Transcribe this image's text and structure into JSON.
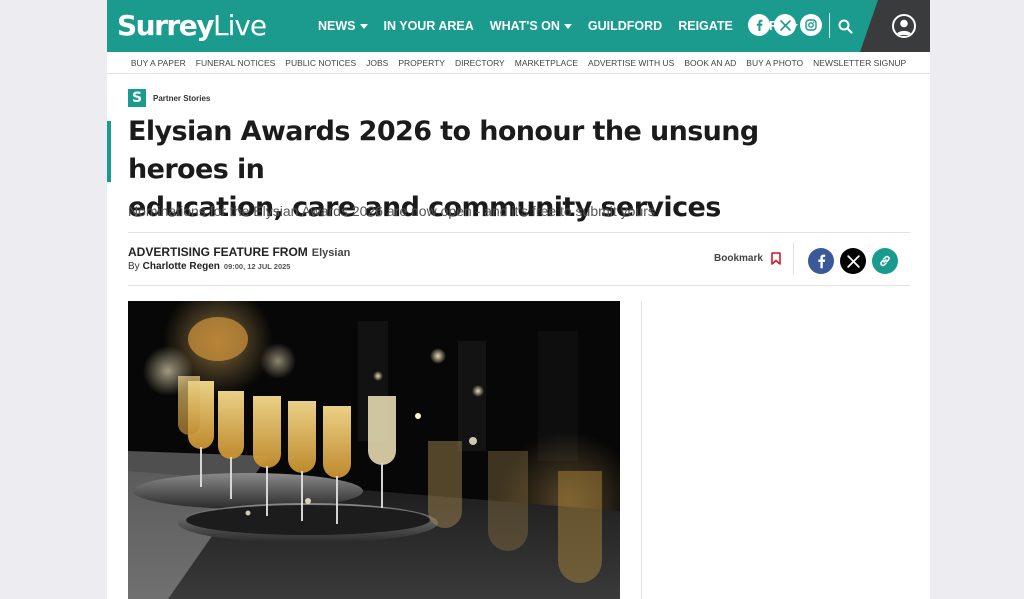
{
  "header": {
    "logo_part1": "Surrey",
    "logo_part2": "Live",
    "nav": [
      {
        "label": "NEWS",
        "dropdown": true
      },
      {
        "label": "IN YOUR AREA",
        "dropdown": false
      },
      {
        "label": "WHAT'S ON",
        "dropdown": true
      },
      {
        "label": "GUILDFORD",
        "dropdown": false
      },
      {
        "label": "REIGATE",
        "dropdown": false
      },
      {
        "label": "MORE",
        "dropdown": true
      }
    ],
    "social": [
      "facebook-icon",
      "x-icon",
      "instagram-icon"
    ],
    "brand_color": "#1a9b8e",
    "account_bg": "#3a3b3c"
  },
  "subnav": [
    "BUY A PAPER",
    "FUNERAL NOTICES",
    "PUBLIC NOTICES",
    "JOBS",
    "PROPERTY",
    "DIRECTORY",
    "MARKETPLACE",
    "ADVERTISE WITH US",
    "BOOK AN AD",
    "BUY A PHOTO",
    "NEWSLETTER SIGNUP"
  ],
  "article": {
    "section_icon": "S",
    "section": "Partner Stories",
    "headline_line1": "Elysian Awards 2026 to honour the unsung heroes in",
    "headline_line2": "education, care and community services",
    "standfirst": "Nominations for the Elysian Awards 2026 are now open - and it's free to submit yours",
    "ad_label": "ADVERTISING FEATURE FROM",
    "ad_brand": "Elysian",
    "by": "By",
    "author": "Charlotte Regen",
    "date": "09:00, 12 JUL 2025",
    "bookmark": "Bookmark",
    "share_colors": {
      "facebook": "#3b5998",
      "x": "#000000",
      "link": "#1a9b8e"
    }
  }
}
